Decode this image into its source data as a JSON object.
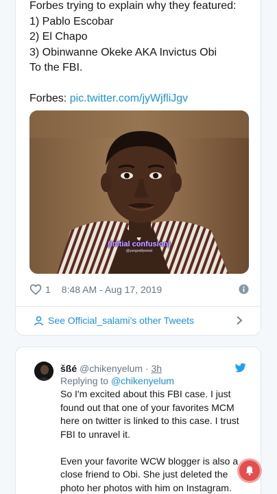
{
  "tweet": {
    "text": "Forbes trying to explain why they featured:\n1) Pablo Escobar\n2) El Chapo\n3) Obinwanne Okeke AKA Invictus Obi\nTo the FBI.\n\nForbes: ",
    "link": "pic.twitter.com/jyWjfliJgv",
    "media": {
      "caption": "(initial confusion)",
      "watermark": "@yungnollywood"
    },
    "likes": "1",
    "timestamp": "8:48 AM - Aug 17, 2019",
    "more_tweets_label": "See Official_salami's other Tweets",
    "icons": {
      "like": "heart-icon",
      "info": "info-icon",
      "profile": "person-icon",
      "more": "chevron-right-icon"
    }
  },
  "reply": {
    "name": "šßé",
    "handle": "@chikenyelum",
    "separator": "·",
    "time": "3h",
    "replying_prefix": "Replying to ",
    "replying_to": "@chikenyelum",
    "text": "So I'm excited about this FBI case. I just found out that one of your favorites MCM here on twitter is linked to this case. I trust FBI to unravel it.\n\nEven your favorite WCW blogger is also a close friend to Obi. She just deleted the photo her photos with him on Instagram.",
    "icons": {
      "avatar": "avatar",
      "brand": "twitter-bird-icon"
    }
  },
  "fab": {
    "icon": "bell-icon"
  },
  "colors": {
    "link": "#1b95e0",
    "muted": "#657786",
    "text": "#14171a",
    "fab": "#e34e4e"
  }
}
